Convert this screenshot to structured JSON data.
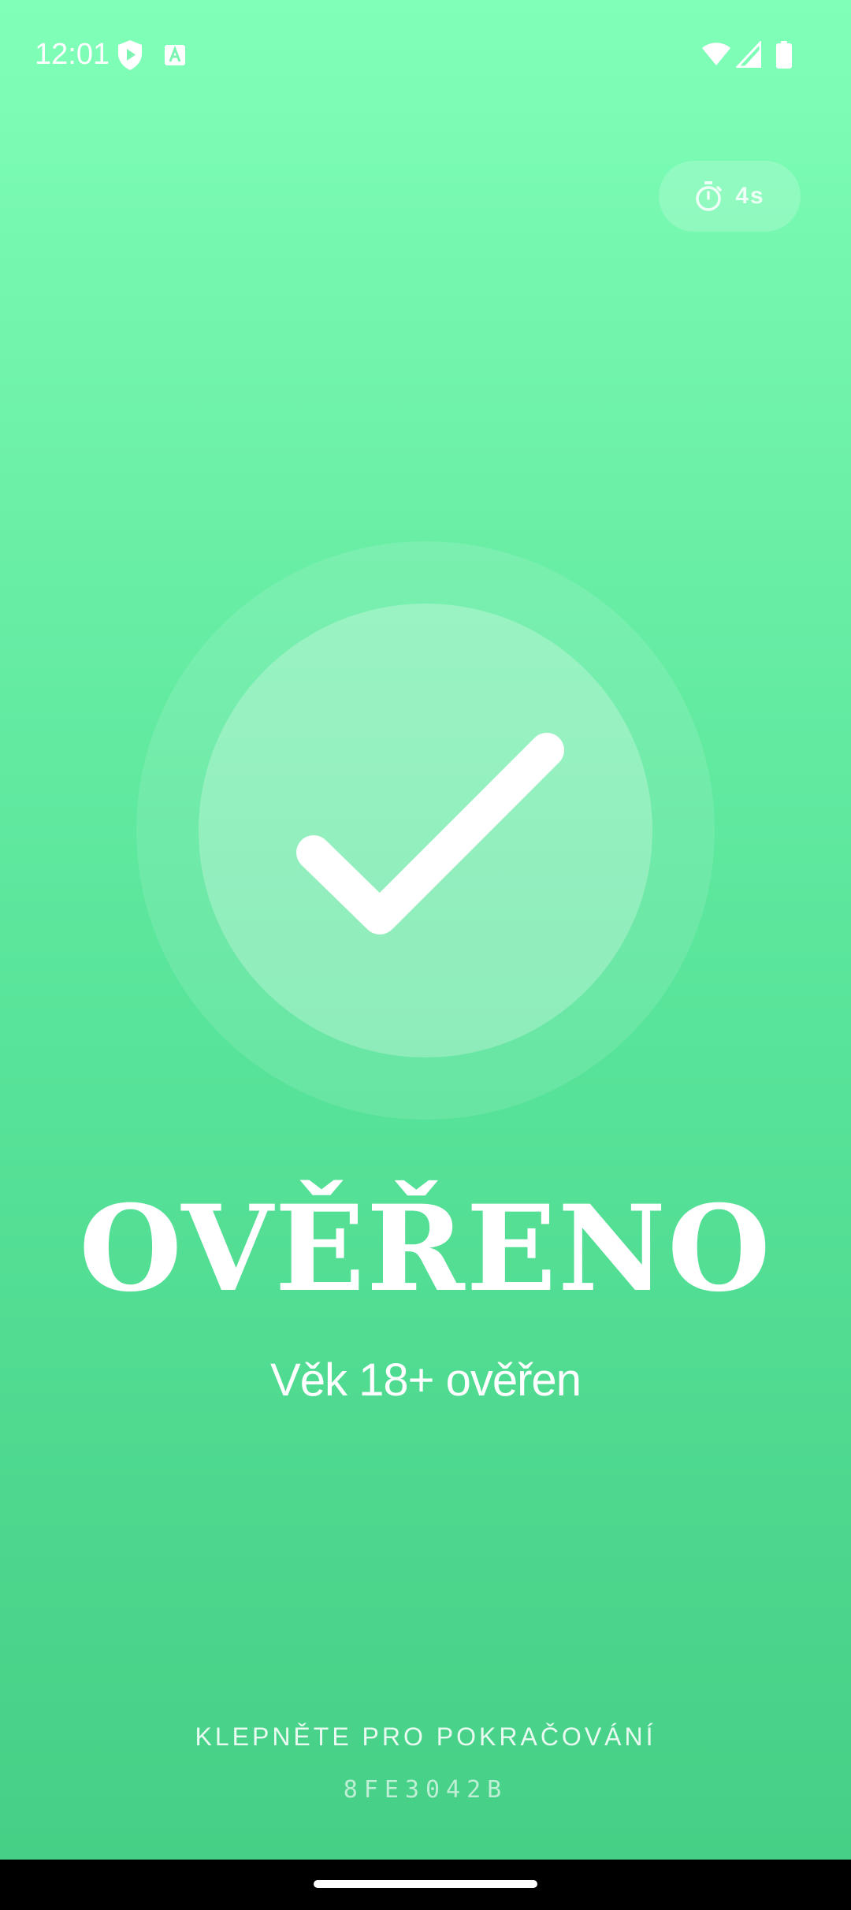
{
  "status_bar": {
    "time": "12:01",
    "icons": [
      "shield-play-icon",
      "text-a-icon",
      "wifi-icon",
      "signal-icon",
      "battery-icon"
    ]
  },
  "timer": {
    "icon": "stopwatch-icon",
    "label": "4s"
  },
  "badge": {
    "icon": "checkmark-icon"
  },
  "title": "OVĚŘENO",
  "subtitle": "Věk 18+ ověřen",
  "tap_hint": "KLEPNĚTE PRO POKRAČOVÁNÍ",
  "code": "8FE3042B",
  "colors": {
    "background_top": "#80ffb8",
    "background_bottom": "#46cf86",
    "foreground": "#ffffff"
  }
}
